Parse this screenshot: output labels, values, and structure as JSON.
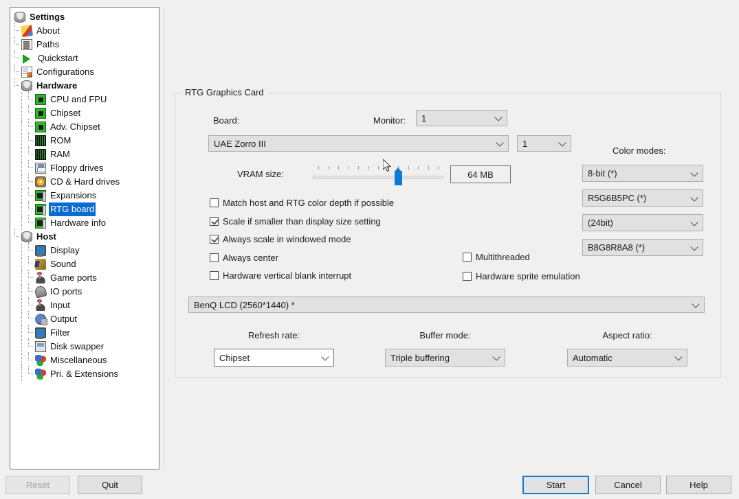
{
  "window": {
    "background_color": "#f0f0f0",
    "accent_color": "#0a7cd5",
    "selection_color": "#0a6cd0"
  },
  "sidebar": {
    "items": [
      {
        "label": "Settings",
        "icon": "disk-icon",
        "depth": 0,
        "bold": true,
        "selected": false
      },
      {
        "label": "About",
        "icon": "pencil-icon",
        "depth": 1,
        "bold": false,
        "selected": false
      },
      {
        "label": "Paths",
        "icon": "paths-icon",
        "depth": 1,
        "bold": false,
        "selected": false
      },
      {
        "label": "Quickstart",
        "icon": "play-icon",
        "depth": 1,
        "bold": false,
        "selected": false
      },
      {
        "label": "Configurations",
        "icon": "config-icon",
        "depth": 1,
        "bold": false,
        "selected": false
      },
      {
        "label": "Hardware",
        "icon": "disk-icon",
        "depth": 1,
        "bold": true,
        "selected": false
      },
      {
        "label": "CPU and FPU",
        "icon": "chip-icon",
        "depth": 2,
        "bold": false,
        "selected": false
      },
      {
        "label": "Chipset",
        "icon": "chip-icon",
        "depth": 2,
        "bold": false,
        "selected": false
      },
      {
        "label": "Adv. Chipset",
        "icon": "chip-icon",
        "depth": 2,
        "bold": false,
        "selected": false
      },
      {
        "label": "ROM",
        "icon": "rom-icon",
        "depth": 2,
        "bold": false,
        "selected": false
      },
      {
        "label": "RAM",
        "icon": "rom-icon",
        "depth": 2,
        "bold": false,
        "selected": false
      },
      {
        "label": "Floppy drives",
        "icon": "floppy-icon",
        "depth": 2,
        "bold": false,
        "selected": false
      },
      {
        "label": "CD & Hard drives",
        "icon": "cd-icon",
        "depth": 2,
        "bold": false,
        "selected": false
      },
      {
        "label": "Expansions",
        "icon": "expansion-icon",
        "depth": 2,
        "bold": false,
        "selected": false
      },
      {
        "label": "RTG board",
        "icon": "expansion-icon",
        "depth": 2,
        "bold": false,
        "selected": true
      },
      {
        "label": "Hardware info",
        "icon": "expansion-icon",
        "depth": 2,
        "bold": false,
        "selected": false
      },
      {
        "label": "Host",
        "icon": "disk-icon",
        "depth": 1,
        "bold": true,
        "selected": false
      },
      {
        "label": "Display",
        "icon": "monitor-icon",
        "depth": 2,
        "bold": false,
        "selected": false
      },
      {
        "label": "Sound",
        "icon": "sound-icon",
        "depth": 2,
        "bold": false,
        "selected": false
      },
      {
        "label": "Game ports",
        "icon": "joystick-icon",
        "depth": 2,
        "bold": false,
        "selected": false
      },
      {
        "label": "IO ports",
        "icon": "ioports-icon",
        "depth": 2,
        "bold": false,
        "selected": false
      },
      {
        "label": "Input",
        "icon": "joystick-icon",
        "depth": 2,
        "bold": false,
        "selected": false
      },
      {
        "label": "Output",
        "icon": "output-icon",
        "depth": 2,
        "bold": false,
        "selected": false
      },
      {
        "label": "Filter",
        "icon": "monitor-icon",
        "depth": 2,
        "bold": false,
        "selected": false
      },
      {
        "label": "Disk swapper",
        "icon": "diskswap-icon",
        "depth": 2,
        "bold": false,
        "selected": false
      },
      {
        "label": "Miscellaneous",
        "icon": "misc-icon",
        "depth": 2,
        "bold": false,
        "selected": false
      },
      {
        "label": "Pri. & Extensions",
        "icon": "misc-icon",
        "depth": 2,
        "bold": false,
        "selected": false
      }
    ]
  },
  "main": {
    "groupbox_title": "RTG Graphics Card",
    "board_label": "Board:",
    "monitor_label": "Monitor:",
    "monitor_value": "1",
    "board_value": "UAE Zorro III",
    "board_index_value": "1",
    "vram_label": "VRAM size:",
    "vram_value": "64 MB",
    "slider": {
      "ticks": 13,
      "thumb_index": 9,
      "min_index": 1,
      "max_index": 13
    },
    "color_modes_label": "Color modes:",
    "color_modes": [
      {
        "value": "8-bit (*)"
      },
      {
        "value": "R5G6B5PC (*)"
      },
      {
        "value": "(24bit)"
      },
      {
        "value": "B8G8R8A8 (*)"
      }
    ],
    "checkboxes_left": [
      {
        "label": "Match host and RTG color depth if possible",
        "checked": false
      },
      {
        "label": "Scale if smaller than display size setting",
        "checked": true
      },
      {
        "label": "Always scale in windowed mode",
        "checked": true
      },
      {
        "label": "Always center",
        "checked": false
      },
      {
        "label": "Hardware vertical blank interrupt",
        "checked": false
      }
    ],
    "checkboxes_right": [
      {
        "label": "Multithreaded",
        "checked": false
      },
      {
        "label": "Hardware sprite emulation",
        "checked": false
      }
    ],
    "display_value": "BenQ LCD (2560*1440) *",
    "bottom_selects": [
      {
        "label": "Refresh rate:",
        "value": "Chipset",
        "style": "white"
      },
      {
        "label": "Buffer mode:",
        "value": "Triple buffering",
        "style": "grey"
      },
      {
        "label": "Aspect ratio:",
        "value": "Automatic",
        "style": "grey"
      }
    ]
  },
  "footer": {
    "reset_label": "Reset",
    "quit_label": "Quit",
    "start_label": "Start",
    "cancel_label": "Cancel",
    "help_label": "Help"
  }
}
